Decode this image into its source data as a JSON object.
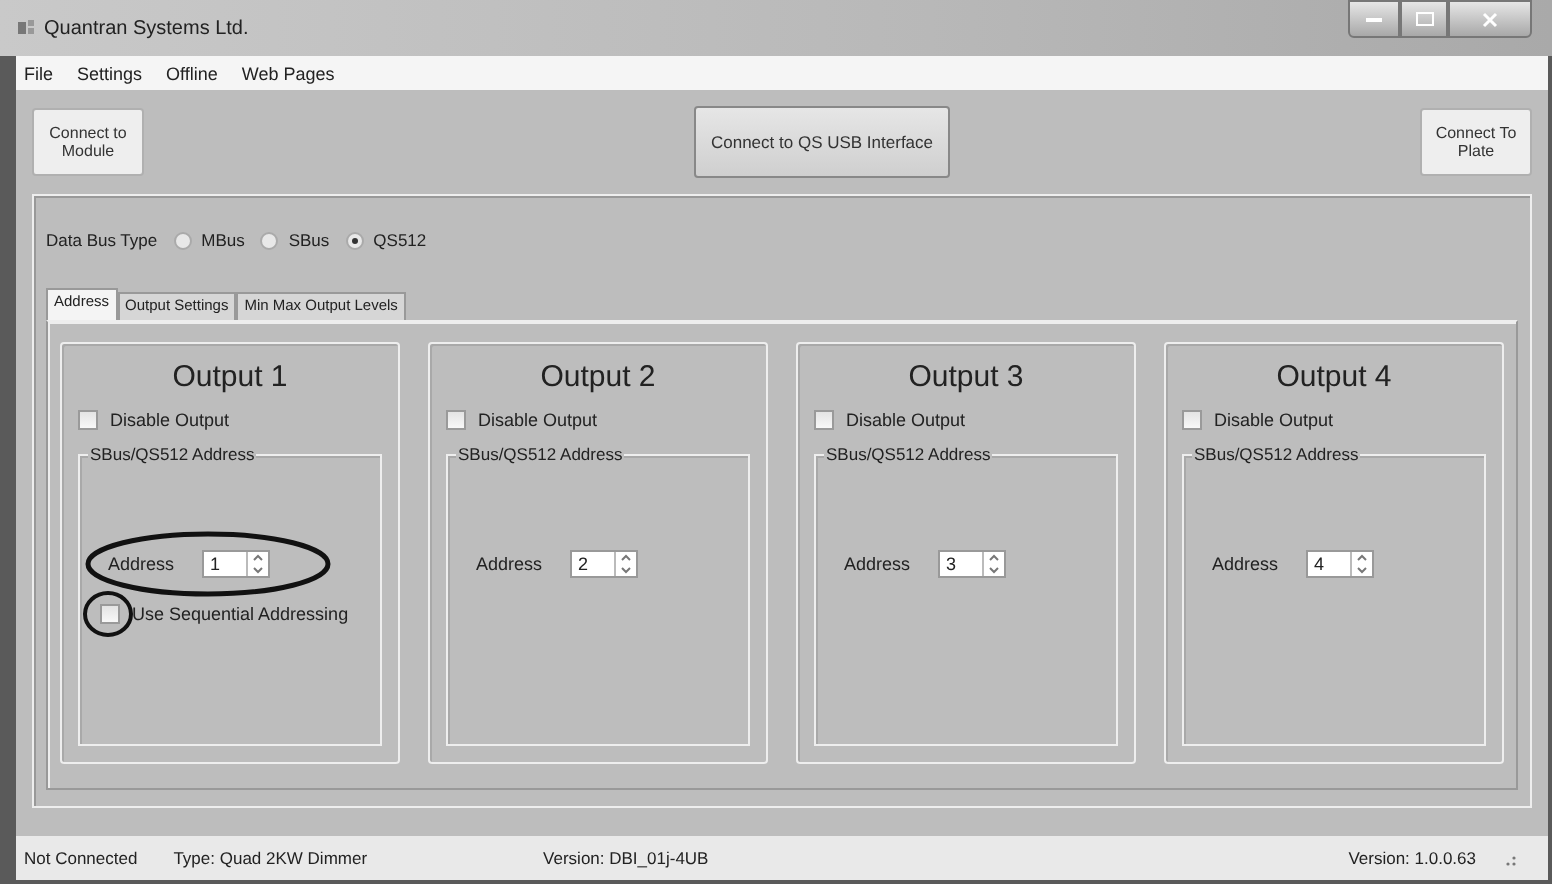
{
  "window": {
    "title": "Quantran Systems Ltd."
  },
  "menu": [
    "File",
    "Settings",
    "Offline",
    "Web Pages"
  ],
  "toolbar": [
    {
      "label": "Connect to Module",
      "kind": "side"
    },
    {
      "label": "Connect to QS USB Interface",
      "kind": "wide"
    },
    {
      "label": "Connect To Plate",
      "kind": "side"
    }
  ],
  "data_bus": {
    "label": "Data Bus Type",
    "options": [
      {
        "label": "MBus",
        "selected": false
      },
      {
        "label": "SBus",
        "selected": false
      },
      {
        "label": "QS512",
        "selected": true
      }
    ]
  },
  "tabs": [
    {
      "label": "Address",
      "selected": true
    },
    {
      "label": "Output Settings",
      "selected": false
    },
    {
      "label": "Min Max Output Levels",
      "selected": false
    }
  ],
  "outputs": [
    {
      "title": "Output 1",
      "disable": {
        "label": "Disable Output",
        "checked": false
      },
      "group_title": "SBus/QS512 Address",
      "address_label": "Address",
      "address": "1",
      "sequential": {
        "label": "Use Sequential Addressing",
        "checked": false
      },
      "annotated": true
    },
    {
      "title": "Output 2",
      "disable": {
        "label": "Disable Output",
        "checked": false
      },
      "group_title": "SBus/QS512 Address",
      "address_label": "Address",
      "address": "2",
      "annotated": false
    },
    {
      "title": "Output 3",
      "disable": {
        "label": "Disable Output",
        "checked": false
      },
      "group_title": "SBus/QS512 Address",
      "address_label": "Address",
      "address": "3",
      "annotated": false
    },
    {
      "title": "Output 4",
      "disable": {
        "label": "Disable Output",
        "checked": false
      },
      "group_title": "SBus/QS512 Address",
      "address_label": "Address",
      "address": "4",
      "annotated": false
    }
  ],
  "status_bar": {
    "left": [
      "Not Connected",
      "Type: Quad 2KW Dimmer",
      "Version: DBI_01j-4UB"
    ],
    "right": "Version: 1.0.0.63"
  }
}
